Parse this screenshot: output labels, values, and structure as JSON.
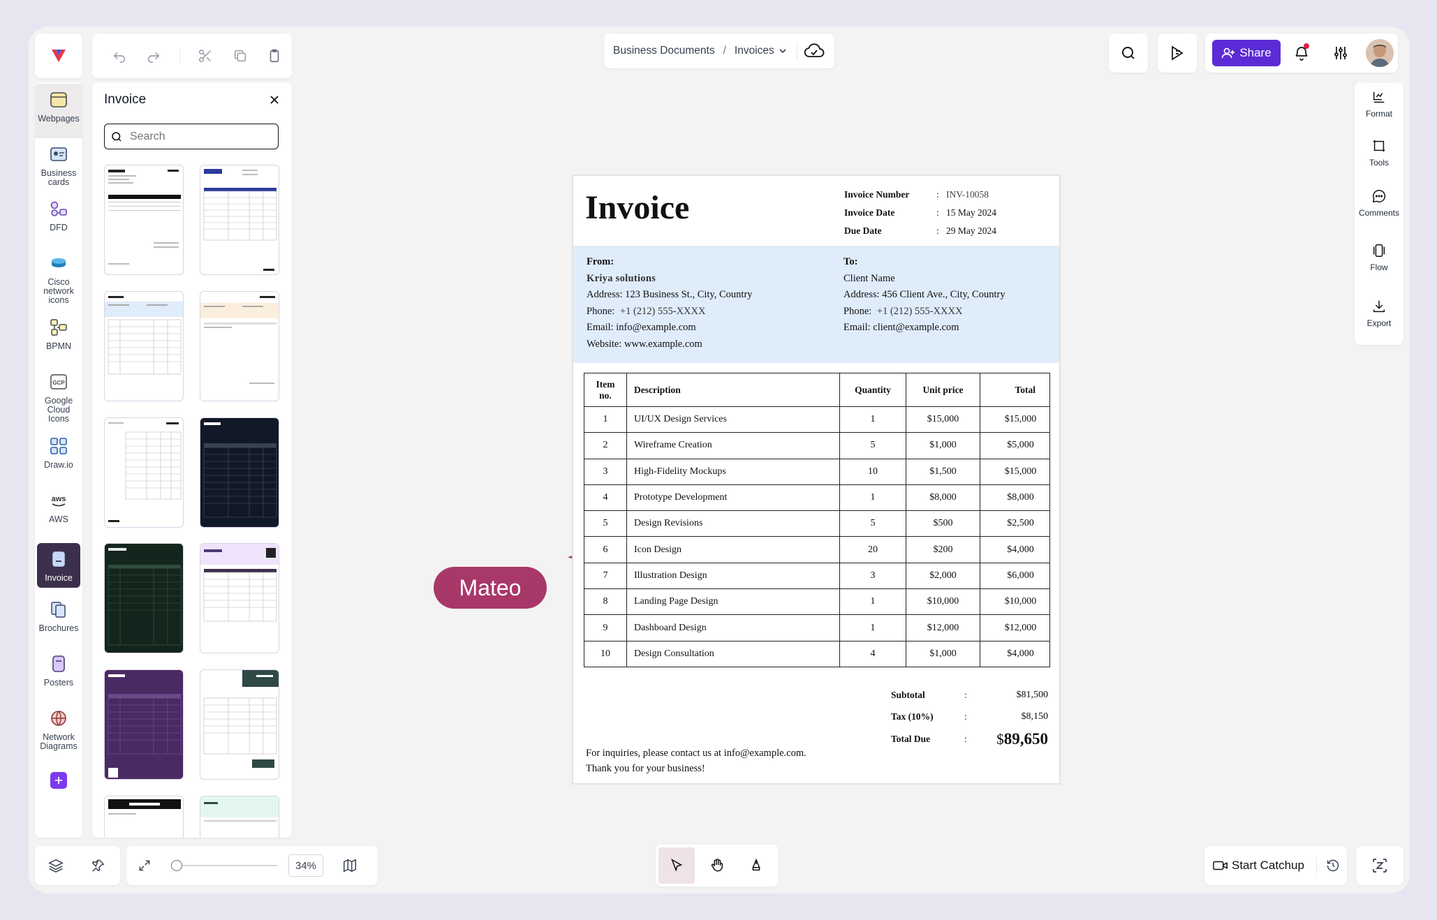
{
  "app": {
    "logo": "app-logo"
  },
  "toolbar": {
    "undo": "undo",
    "redo": "redo",
    "cut": "cut",
    "copy": "copy",
    "paste": "paste"
  },
  "breadcrumb": {
    "root": "Business Documents",
    "separator": "/",
    "current": "Invoices"
  },
  "header": {
    "share_label": "Share"
  },
  "sidebar": {
    "categories": [
      {
        "label": "Webpages"
      },
      {
        "label": "Business\ncards"
      },
      {
        "label": "DFD"
      },
      {
        "label": "Cisco\nnetwork\nicons"
      },
      {
        "label": "BPMN"
      },
      {
        "label": "Google\nCloud\nIcons"
      },
      {
        "label": "Draw.io"
      },
      {
        "label": "AWS"
      },
      {
        "label": "Invoice"
      },
      {
        "label": "Brochures"
      },
      {
        "label": "Posters"
      },
      {
        "label": "Network\nDiagrams"
      }
    ]
  },
  "templates": {
    "title": "Invoice",
    "search_placeholder": "Search"
  },
  "right_tools": [
    {
      "label": "Format"
    },
    {
      "label": "Tools"
    },
    {
      "label": "Comments"
    },
    {
      "label": "Flow"
    },
    {
      "label": "Export"
    }
  ],
  "cursor": {
    "name": "Mateo"
  },
  "bottom": {
    "zoom": "34%",
    "catchup_label": "Start Catchup"
  },
  "invoice": {
    "title": "Invoice",
    "meta": [
      {
        "label": "Invoice Number",
        "sep": ":",
        "value": "INV-10058"
      },
      {
        "label": "Invoice Date",
        "sep": ":",
        "value": "15 May 2024"
      },
      {
        "label": "Due Date",
        "sep": ":",
        "value": "29 May 2024"
      }
    ],
    "from": {
      "heading": "From:",
      "name": "Kriya solutions",
      "address": "Address: 123 Business St., City, Country",
      "phone_label": "Phone:",
      "phone": "+1 (212) 555-XXXX",
      "email": "Email: info@example.com",
      "website": "Website: www.example.com"
    },
    "to": {
      "heading": "To:",
      "name": "Client Name",
      "address": "Address: 456 Client Ave., City, Country",
      "phone_label": "Phone:",
      "phone": "+1 (212) 555-XXXX",
      "email": "Email: client@example.com"
    },
    "columns": {
      "item": "Item\nno.",
      "description": "Description",
      "quantity": "Quantity",
      "unit_price": "Unit price",
      "total": "Total"
    },
    "rows": [
      {
        "no": "1",
        "desc": "UI/UX Design Services",
        "qty": "1",
        "price": "$15,000",
        "total": "$15,000"
      },
      {
        "no": "2",
        "desc": "Wireframe Creation",
        "qty": "5",
        "price": "$1,000",
        "total": "$5,000"
      },
      {
        "no": "3",
        "desc": "High-Fidelity Mockups",
        "qty": "10",
        "price": "$1,500",
        "total": "$15,000"
      },
      {
        "no": "4",
        "desc": "Prototype Development",
        "qty": "1",
        "price": "$8,000",
        "total": "$8,000"
      },
      {
        "no": "5",
        "desc": "Design Revisions",
        "qty": "5",
        "price": "$500",
        "total": "$2,500"
      },
      {
        "no": "6",
        "desc": "Icon Design",
        "qty": "20",
        "price": "$200",
        "total": "$4,000"
      },
      {
        "no": "7",
        "desc": "Illustration Design",
        "qty": "3",
        "price": "$2,000",
        "total": "$6,000"
      },
      {
        "no": "8",
        "desc": "Landing Page Design",
        "qty": "1",
        "price": "$10,000",
        "total": "$10,000"
      },
      {
        "no": "9",
        "desc": "Dashboard Design",
        "qty": "1",
        "price": "$12,000",
        "total": "$12,000"
      },
      {
        "no": "10",
        "desc": "Design Consultation",
        "qty": "4",
        "price": "$1,000",
        "total": "$4,000"
      }
    ],
    "subtotal": {
      "label": "Subtotal",
      "sep": ":",
      "value": "$81,500"
    },
    "tax": {
      "label": "Tax (10%)",
      "sep": ":",
      "value": "$8,150"
    },
    "total_due": {
      "label": "Total Due",
      "sep": ":",
      "currency": "$",
      "value": "89,650"
    },
    "footer_line1": "For inquiries, please contact us at info@example.com.",
    "footer_line2": "Thank you for your business!"
  },
  "colors": {
    "accent": "#5b2bd6",
    "info_band": "#dfecfa",
    "cursor": "#a8386a",
    "active_cat": "#3b2f4c"
  }
}
